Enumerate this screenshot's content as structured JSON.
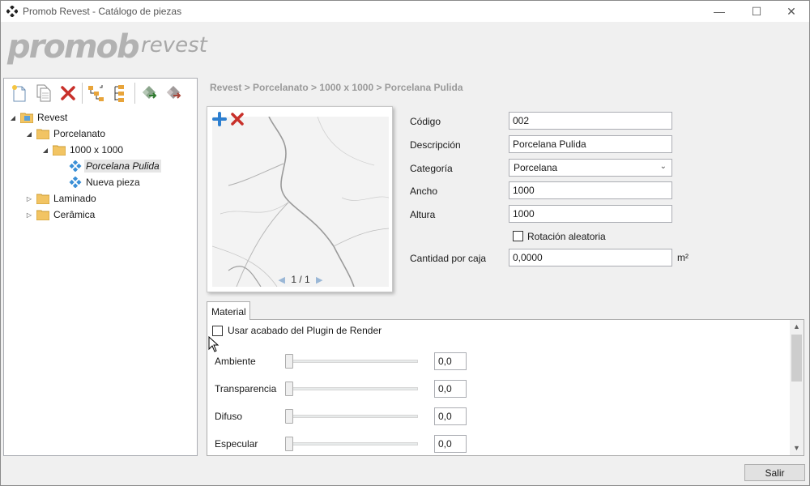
{
  "window": {
    "title": "Promob Revest - Catálogo de piezas",
    "minimize": "—",
    "maximize": "☐",
    "close": "✕"
  },
  "logo": {
    "brand": "promob",
    "product": "revest"
  },
  "toolbar": {
    "icons": [
      "new-item-icon",
      "copy-icon",
      "delete-icon",
      "tree-expand-icon",
      "tree-list-icon",
      "import-icon",
      "export-icon"
    ]
  },
  "tree": {
    "root": "Revest",
    "porcelanato": "Porcelanato",
    "size_folder": "1000 x 1000",
    "selected_item": "Porcelana Pulida",
    "new_item": "Nueva pieza",
    "laminado": "Laminado",
    "ceramica": "Cerâmica"
  },
  "breadcrumb": "Revest > Porcelanato > 1000 x 1000 > Porcelana Pulida",
  "preview": {
    "page": "1 / 1",
    "prev": "◀",
    "next": "▶"
  },
  "form": {
    "codigo_label": "Código",
    "codigo_value": "002",
    "descripcion_label": "Descripción",
    "descripcion_value": "Porcelana Pulida",
    "categoria_label": "Categoría",
    "categoria_value": "Porcelana",
    "ancho_label": "Ancho",
    "ancho_value": "1000",
    "altura_label": "Altura",
    "altura_value": "1000",
    "rotacion_label": "Rotación aleatoria",
    "rotacion_checked": false,
    "cantidad_label": "Cantidad por caja",
    "cantidad_value": "0,0000",
    "cantidad_unit": "m²"
  },
  "material": {
    "tab_label": "Material",
    "plugin_label": "Usar acabado del Plugin de Render",
    "plugin_checked": false,
    "rows": [
      {
        "label": "Ambiente",
        "value": "0,0"
      },
      {
        "label": "Transparencia",
        "value": "0,0"
      },
      {
        "label": "Difuso",
        "value": "0,0"
      },
      {
        "label": "Especular",
        "value": "0,0"
      }
    ]
  },
  "footer": {
    "exit_label": "Salir"
  }
}
